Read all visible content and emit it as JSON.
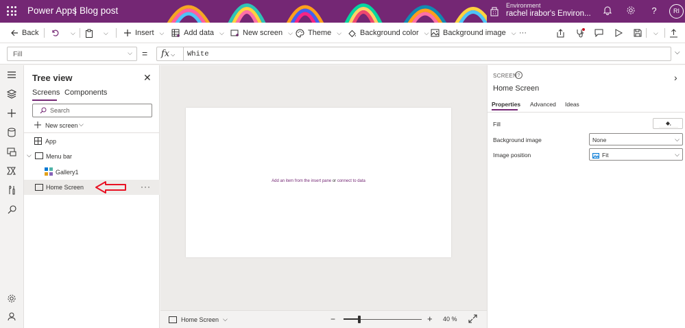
{
  "header": {
    "app_name": "Power Apps",
    "separator": "|",
    "doc_name": "Blog post",
    "environment_label": "Environment",
    "environment_name": "rachel irabor's Environ...",
    "avatar_initials": "RI"
  },
  "commandbar": {
    "back_label": "Back",
    "insert_label": "Insert",
    "add_data_label": "Add data",
    "new_screen_label": "New screen",
    "theme_label": "Theme",
    "background_color_label": "Background color",
    "background_image_label": "Background image",
    "more_label": "···"
  },
  "formula_bar": {
    "property": "Fill",
    "equals": "=",
    "fx_label": "fx",
    "formula": "White"
  },
  "tree_view": {
    "title": "Tree view",
    "close_label": "✕",
    "tabs": [
      "Screens",
      "Components"
    ],
    "search_placeholder": "Search",
    "new_screen_label": "New screen",
    "items": [
      {
        "label": "App"
      },
      {
        "label": "Menu bar"
      },
      {
        "label": "Gallery1"
      },
      {
        "label": "Home Screen"
      }
    ],
    "more_label": "···"
  },
  "canvas": {
    "placeholder_part1": "Add an item from the insert pane",
    "placeholder_mid": " or ",
    "placeholder_part2": "connect to data"
  },
  "bottom_bar": {
    "screen_name": "Home Screen",
    "zoom_minus": "−",
    "zoom_plus": "+",
    "zoom_value": "40  %",
    "zoom_level": 0.4
  },
  "right_panel": {
    "kicker": "SCREEN",
    "help_label": "?",
    "collapse_label": "›",
    "title": "Home Screen",
    "tabs": [
      "Properties",
      "Advanced",
      "Ideas"
    ],
    "fill_label": "Fill",
    "fill_color": "#ffffff",
    "background_image_label": "Background image",
    "background_image_value": "None",
    "image_position_label": "Image position",
    "image_position_value": "Fit"
  },
  "colors": {
    "brand": "#742774",
    "annotation_arrow": "#e81123"
  },
  "icons": {
    "left_rail": [
      "hamburger-icon",
      "layers-icon",
      "plus-icon",
      "database-icon",
      "media-icon",
      "power-automate-icon",
      "tools-icon",
      "search-icon",
      "settings-icon",
      "virtual-agent-icon"
    ]
  }
}
